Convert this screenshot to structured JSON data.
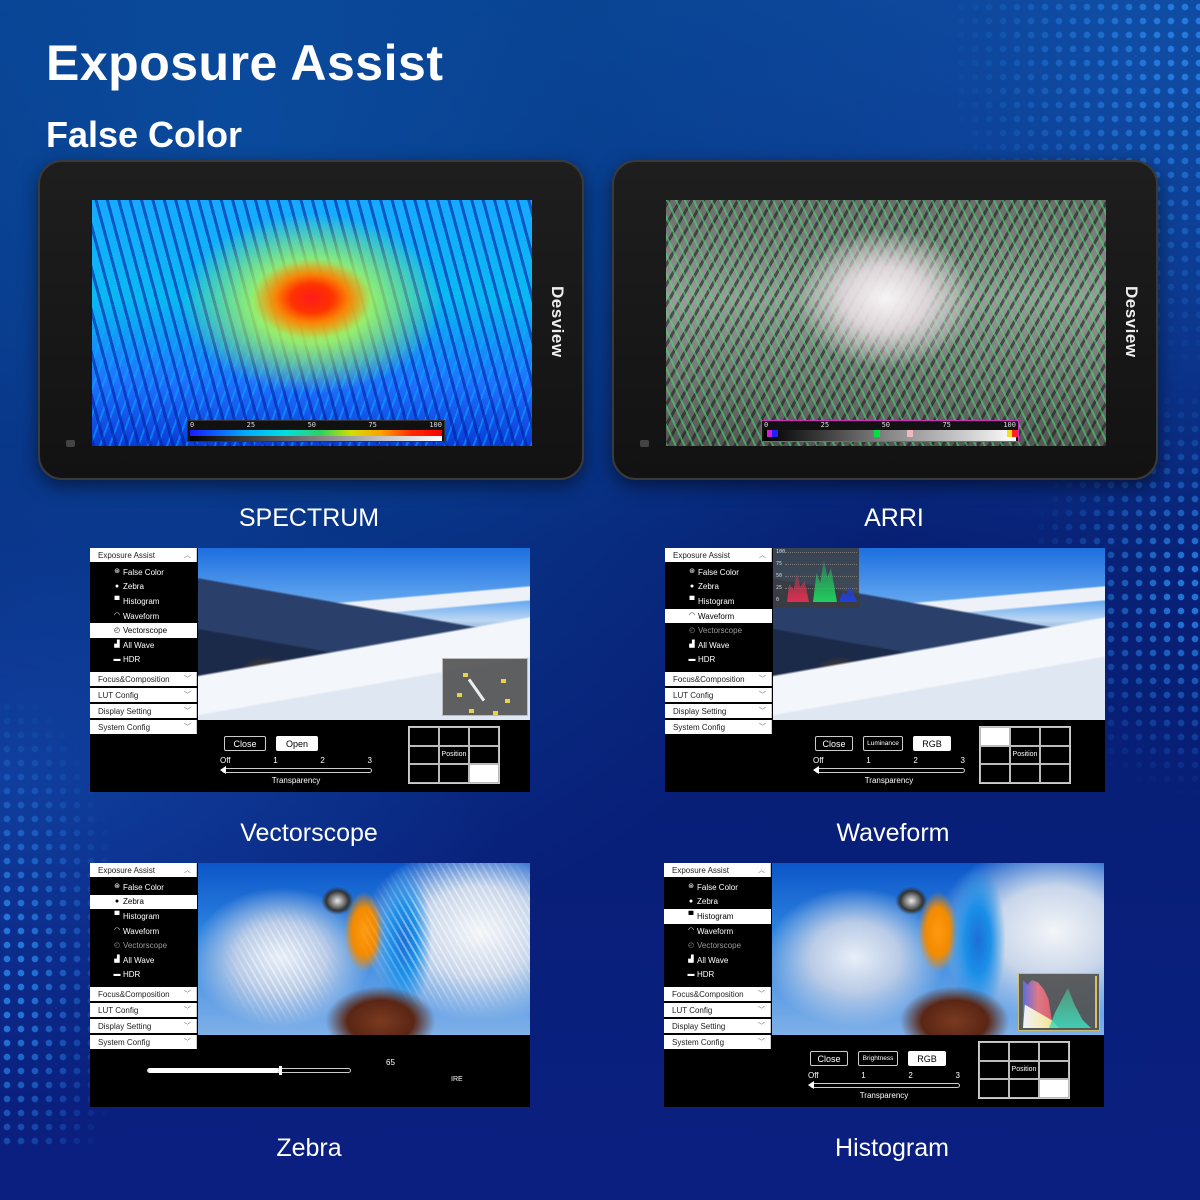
{
  "header": {
    "title": "Exposure Assist",
    "subtitle": "False Color"
  },
  "brand": "Desview",
  "devices": [
    {
      "caption": "SPECTRUM",
      "mode": "spectrum",
      "scale_ticks": [
        "0",
        "25",
        "50",
        "75",
        "100"
      ]
    },
    {
      "caption": "ARRI",
      "mode": "arri",
      "scale_ticks": [
        "0",
        "25",
        "50",
        "75",
        "100"
      ],
      "swatches": [
        {
          "at": 0.01,
          "color": "#d020d0"
        },
        {
          "at": 0.03,
          "color": "#2020ff"
        },
        {
          "at": 0.44,
          "color": "#00e040"
        },
        {
          "at": 0.57,
          "color": "#f0b8c0"
        },
        {
          "at": 0.97,
          "color": "#f0e020"
        },
        {
          "at": 0.99,
          "color": "#ff2020"
        }
      ]
    }
  ],
  "menu": {
    "header": "Exposure Assist",
    "items": [
      "False Color",
      "Zebra",
      "Histogram",
      "Waveform",
      "Vectorscope",
      "All Wave",
      "HDR"
    ],
    "icons": [
      "palette-icon",
      "circle-icon",
      "histogram-icon",
      "waveform-icon",
      "vectorscope-icon",
      "all-wave-icon",
      "hdr-icon"
    ],
    "sections": [
      "Focus&Composition",
      "LUT Config",
      "Display Setting",
      "System Config"
    ]
  },
  "panels": {
    "vectorscope": {
      "caption": "Vectorscope",
      "selected_item": 4,
      "buttons": [
        "Close",
        "Open"
      ],
      "active_button": 1,
      "slider_labels": [
        "Off",
        "1",
        "2",
        "3"
      ],
      "slider_caption": "Transparency",
      "transparency_level": 0,
      "position_label": "Position",
      "position_cell": 8
    },
    "waveform": {
      "caption": "Waveform",
      "selected_item": 3,
      "buttons": [
        "Close",
        "Luminance",
        "RGB"
      ],
      "active_button": 2,
      "slider_labels": [
        "Off",
        "1",
        "2",
        "3"
      ],
      "slider_caption": "Transparency",
      "transparency_level": 0,
      "position_label": "Position",
      "position_cell": 0,
      "scope_labels": [
        "100",
        "75",
        "50",
        "25",
        "0"
      ]
    },
    "zebra": {
      "caption": "Zebra",
      "selected_item": 1,
      "ire_value": "65",
      "ire_unit": "IRE",
      "ire_fraction": 0.65
    },
    "histogram": {
      "caption": "Histogram",
      "selected_item": 2,
      "buttons": [
        "Close",
        "Brightness",
        "RGB"
      ],
      "active_button": 2,
      "slider_labels": [
        "Off",
        "1",
        "2",
        "3"
      ],
      "slider_caption": "Transparency",
      "transparency_level": 0,
      "position_label": "Position",
      "position_cell": 8
    }
  },
  "colors": {
    "background": "#071f73",
    "accent_dots": "#2882e6",
    "device_body": "#1a1a1a"
  }
}
